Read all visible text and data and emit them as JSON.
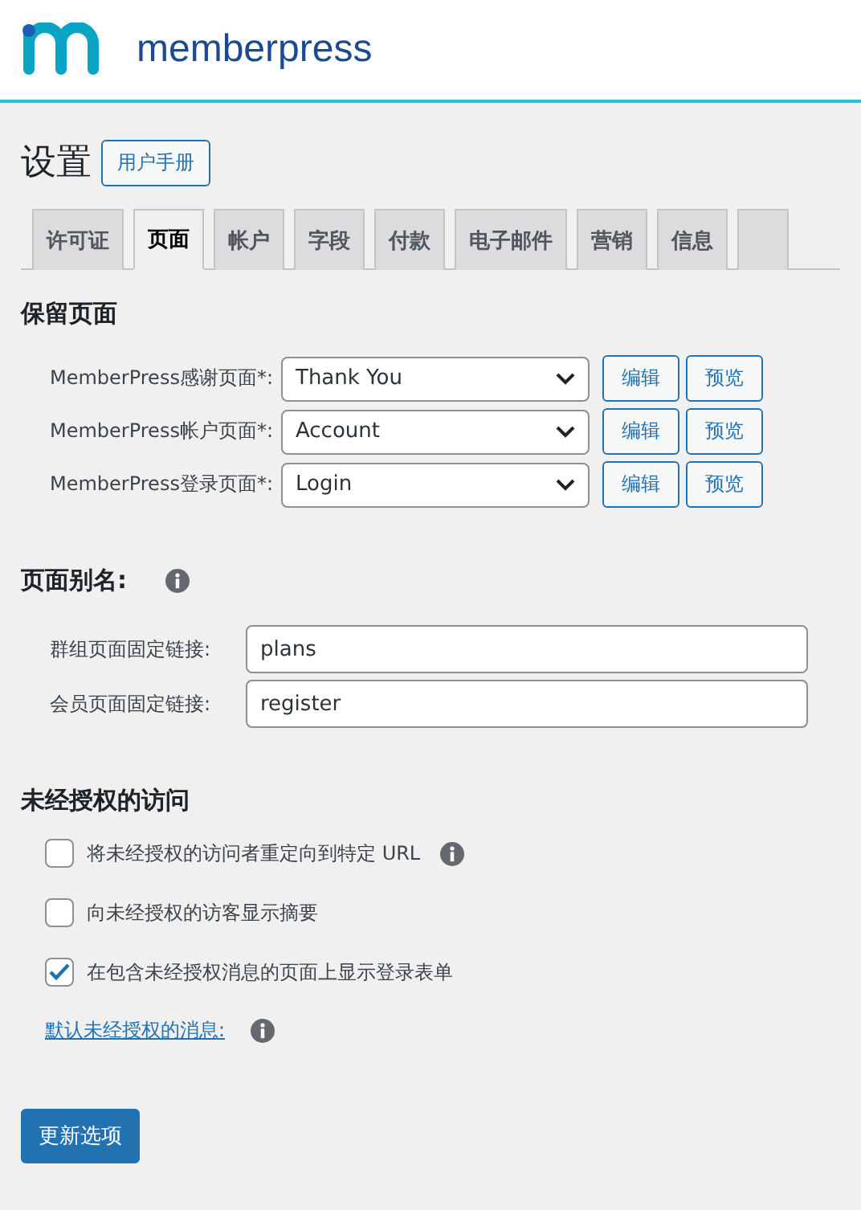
{
  "header": {
    "brand": "memberpress"
  },
  "page": {
    "title": "设置",
    "manual_button": "用户手册"
  },
  "tabs": [
    {
      "label": "许可证",
      "selected": false
    },
    {
      "label": "页面",
      "selected": true
    },
    {
      "label": "帐户",
      "selected": false
    },
    {
      "label": "字段",
      "selected": false
    },
    {
      "label": "付款",
      "selected": false
    },
    {
      "label": "电子邮件",
      "selected": false
    },
    {
      "label": "营销",
      "selected": false
    },
    {
      "label": "信息",
      "selected": false
    }
  ],
  "reserved_pages": {
    "heading": "保留页面",
    "rows": [
      {
        "label": "MemberPress感谢页面*:",
        "value": "Thank You",
        "edit": "编辑",
        "preview": "预览"
      },
      {
        "label": "MemberPress帐户页面*:",
        "value": "Account",
        "edit": "编辑",
        "preview": "预览"
      },
      {
        "label": "MemberPress登录页面*:",
        "value": "Login",
        "edit": "编辑",
        "preview": "预览"
      }
    ]
  },
  "page_slugs": {
    "heading": "页面别名:",
    "rows": [
      {
        "label": "群组页面固定链接:",
        "value": "plans"
      },
      {
        "label": "会员页面固定链接:",
        "value": "register"
      }
    ]
  },
  "unauthorized": {
    "heading": "未经授权的访问",
    "options": [
      {
        "label": "将未经授权的访问者重定向到特定 URL",
        "checked": false,
        "info": true
      },
      {
        "label": "向未经授权的访客显示摘要",
        "checked": false,
        "info": false
      },
      {
        "label": "在包含未经授权消息的页面上显示登录表单",
        "checked": true,
        "info": false
      }
    ],
    "message_link": "默认未经授权的消息:"
  },
  "submit_button": "更新选项"
}
